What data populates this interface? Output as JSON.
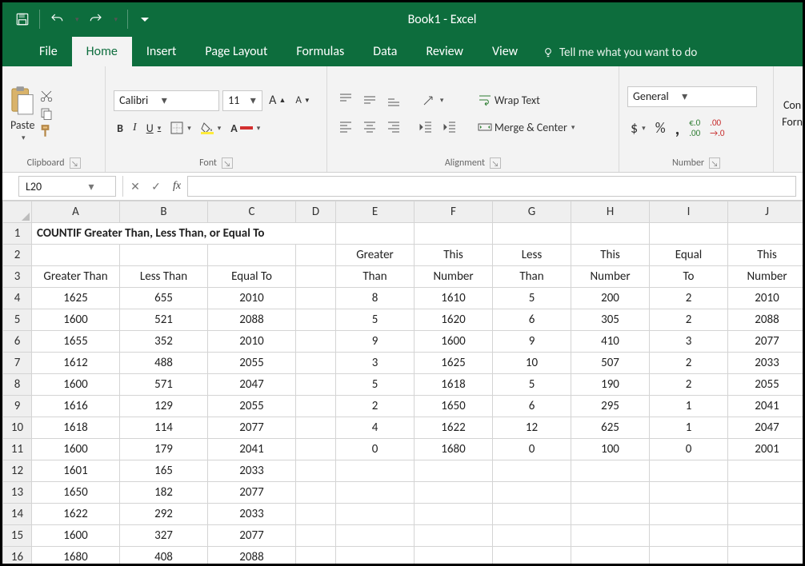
{
  "title": "Book1 - Excel",
  "tabs": [
    "File",
    "Home",
    "Insert",
    "Page Layout",
    "Formulas",
    "Data",
    "Review",
    "View"
  ],
  "active_tab": "Home",
  "tellme": "Tell me what you want to do",
  "groups": {
    "clipboard": {
      "title": "Clipboard",
      "paste": "Paste"
    },
    "font": {
      "title": "Font",
      "name": "Calibri",
      "size": "11"
    },
    "alignment": {
      "title": "Alignment",
      "wrap": "Wrap Text",
      "merge": "Merge & Center"
    },
    "number": {
      "title": "Number",
      "format": "General"
    }
  },
  "cond_label_1": "Con",
  "cond_label_2": "Forn",
  "namebox": "L20",
  "columns": [
    "A",
    "B",
    "C",
    "D",
    "E",
    "F",
    "G",
    "H",
    "I",
    "J"
  ],
  "title_row": "COUNTIF Greater Than, Less Than, or Equal To",
  "header2": {
    "E": "Greater",
    "F": "This",
    "G": "Less",
    "H": "This",
    "I": "Equal",
    "J": "This"
  },
  "header3": {
    "A": "Greater Than",
    "B": "Less Than",
    "C": "Equal To",
    "E": "Than",
    "F": "Number",
    "G": "Than",
    "H": "Number",
    "I": "To",
    "J": "Number"
  },
  "rows": [
    {
      "n": 4,
      "A": "1625",
      "B": "655",
      "C": "2010",
      "E": "8",
      "F": "1610",
      "G": "5",
      "H": "200",
      "I": "2",
      "J": "2010"
    },
    {
      "n": 5,
      "A": "1600",
      "B": "521",
      "C": "2088",
      "E": "5",
      "F": "1620",
      "G": "6",
      "H": "305",
      "I": "2",
      "J": "2088"
    },
    {
      "n": 6,
      "A": "1655",
      "B": "352",
      "C": "2010",
      "E": "9",
      "F": "1600",
      "G": "9",
      "H": "410",
      "I": "3",
      "J": "2077"
    },
    {
      "n": 7,
      "A": "1612",
      "B": "488",
      "C": "2055",
      "E": "3",
      "F": "1625",
      "G": "10",
      "H": "507",
      "I": "2",
      "J": "2033"
    },
    {
      "n": 8,
      "A": "1600",
      "B": "571",
      "C": "2047",
      "E": "5",
      "F": "1618",
      "G": "5",
      "H": "190",
      "I": "2",
      "J": "2055"
    },
    {
      "n": 9,
      "A": "1616",
      "B": "129",
      "C": "2055",
      "E": "2",
      "F": "1650",
      "G": "6",
      "H": "295",
      "I": "1",
      "J": "2041"
    },
    {
      "n": 10,
      "A": "1618",
      "B": "114",
      "C": "2077",
      "E": "4",
      "F": "1622",
      "G": "12",
      "H": "625",
      "I": "1",
      "J": "2047"
    },
    {
      "n": 11,
      "A": "1600",
      "B": "179",
      "C": "2041",
      "E": "0",
      "F": "1680",
      "G": "0",
      "H": "100",
      "I": "0",
      "J": "2001"
    },
    {
      "n": 12,
      "A": "1601",
      "B": "165",
      "C": "2033"
    },
    {
      "n": 13,
      "A": "1650",
      "B": "182",
      "C": "2077"
    },
    {
      "n": 14,
      "A": "1622",
      "B": "292",
      "C": "2033"
    },
    {
      "n": 15,
      "A": "1600",
      "B": "327",
      "C": "2077"
    },
    {
      "n": 16,
      "A": "1680",
      "B": "408",
      "C": "2088"
    }
  ]
}
